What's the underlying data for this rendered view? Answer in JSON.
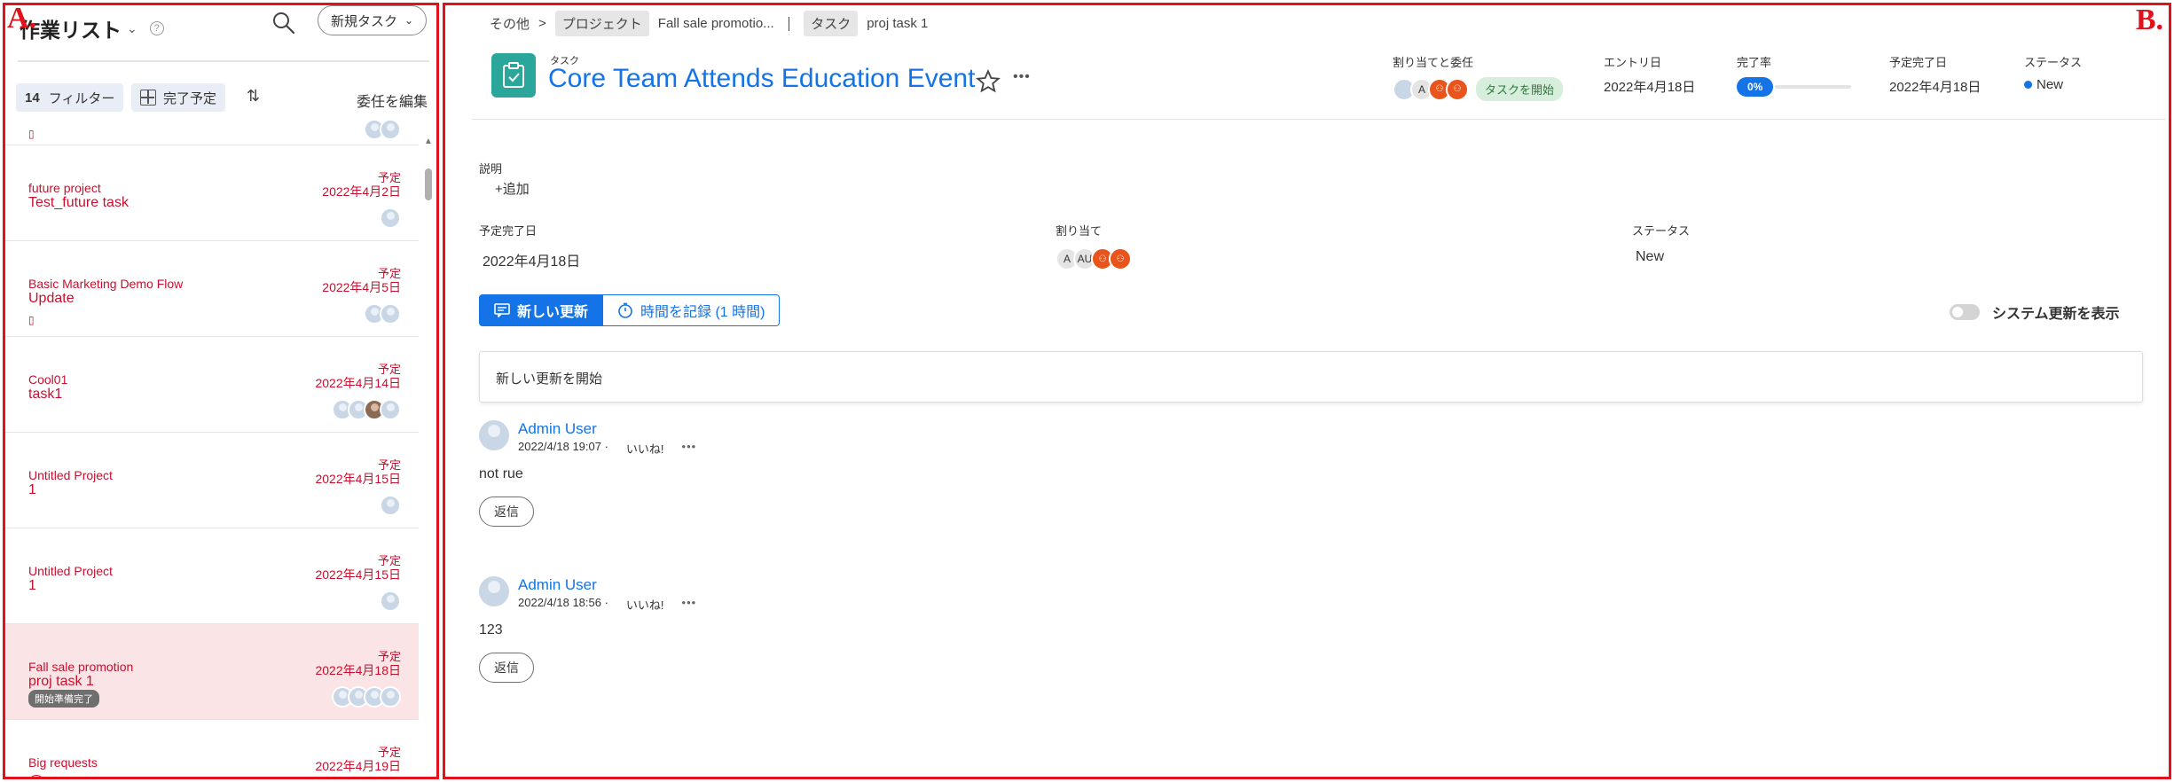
{
  "annotations": {
    "label_a": "A.",
    "label_b": "B."
  },
  "left_panel": {
    "title": "作業リスト",
    "new_task_label": "新規タスク",
    "filter_count": "14",
    "filter_label": "フィルター",
    "due_label": "完了予定",
    "edit_delegation_label": "委任を編集",
    "items": [
      {
        "project": "future project",
        "name": "Test_future task",
        "due_label": "予定",
        "due": "2022年4月2日",
        "badge": ""
      },
      {
        "project": "Basic Marketing Demo Flow",
        "name": "Update",
        "due_label": "予定",
        "due": "2022年4月5日",
        "badge": ""
      },
      {
        "project": "Cool01",
        "name": "task1",
        "due_label": "予定",
        "due": "2022年4月14日",
        "badge": ""
      },
      {
        "project": "Untitled Project",
        "name": "1",
        "due_label": "予定",
        "due": "2022年4月15日",
        "badge": ""
      },
      {
        "project": "Untitled Project",
        "name": "1",
        "due_label": "予定",
        "due": "2022年4月15日",
        "badge": ""
      },
      {
        "project": "Fall sale promotion",
        "name": "proj task 1",
        "due_label": "予定",
        "due": "2022年4月18日",
        "badge": "開始準備完了"
      },
      {
        "project": "Big requests",
        "name": "",
        "due_label": "予定",
        "due": "2022年4月19日",
        "badge": "",
        "warn_count": "1"
      }
    ]
  },
  "breadcrumb": {
    "other": "その他",
    "sep": ">",
    "project_tag": "プロジェクト",
    "project_name": "Fall sale promotio...",
    "task_tag": "タスク",
    "task_name": "proj task 1"
  },
  "task": {
    "kind": "タスク",
    "title": "Core Team Attends Education Event"
  },
  "meta": {
    "assign_label": "割り当てと委任",
    "assign_initial": "A",
    "start_task_label": "タスクを開始",
    "entry_label": "エントリ日",
    "entry_value": "2022年4月18日",
    "progress_label": "完了率",
    "progress_value": "0%",
    "due_label": "予定完了日",
    "due_value": "2022年4月18日",
    "status_label": "ステータス",
    "status_value": "New"
  },
  "details": {
    "description_label": "説明",
    "add_label": "+追加",
    "due_label": "予定完了日",
    "due_value": "2022年4月18日",
    "assign_label": "割り当て",
    "assign_initials_1": "A",
    "assign_initials_2": "AU",
    "status_label": "ステータス",
    "status_value": "New"
  },
  "tabs": {
    "new_update": "新しい更新",
    "log_time": "時間を記録 (1 時間)"
  },
  "system_updates_label": "システム更新を表示",
  "new_update_placeholder": "新しい更新を開始",
  "updates": [
    {
      "author": "Admin User",
      "timestamp": "2022/4/18 19:07 ·",
      "like": "いいね!",
      "body": "not rue",
      "reply": "返信"
    },
    {
      "author": "Admin User",
      "timestamp": "2022/4/18 18:56 ·",
      "like": "いいね!",
      "body": "123",
      "reply": "返信"
    }
  ],
  "colors": {
    "accent": "#1473e6",
    "overdue": "#c8102e",
    "task_icon": "#2aa69b",
    "annotation": "#e0121b"
  }
}
